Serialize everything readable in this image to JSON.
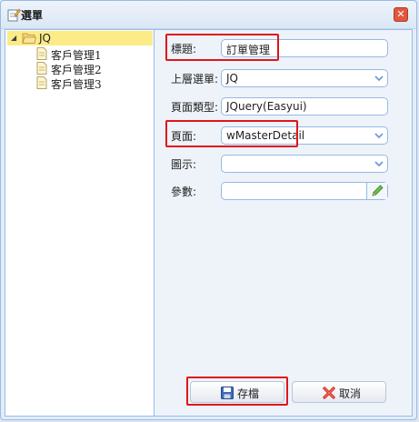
{
  "window": {
    "title": "選單"
  },
  "tree": {
    "root": {
      "label": "JQ"
    },
    "children": [
      {
        "label": "客戶管理1"
      },
      {
        "label": "客戶管理2"
      },
      {
        "label": "客戶管理3"
      }
    ]
  },
  "form": {
    "title_label": "標題:",
    "title_value": "訂單管理",
    "parent_label": "上層選單:",
    "parent_value": "JQ",
    "page_type_label": "頁面類型:",
    "page_type_value": "JQuery(Easyui)",
    "page_label": "頁面:",
    "page_value": "wMasterDetail",
    "icon_label": "圖示:",
    "icon_value": "",
    "param_label": "參數:",
    "param_value": ""
  },
  "buttons": {
    "save_label": "存檔",
    "cancel_label": "取消"
  },
  "colors": {
    "highlight": "#e0151a",
    "border_blue": "#95b8e7",
    "selected_bg": "#fbec88"
  }
}
